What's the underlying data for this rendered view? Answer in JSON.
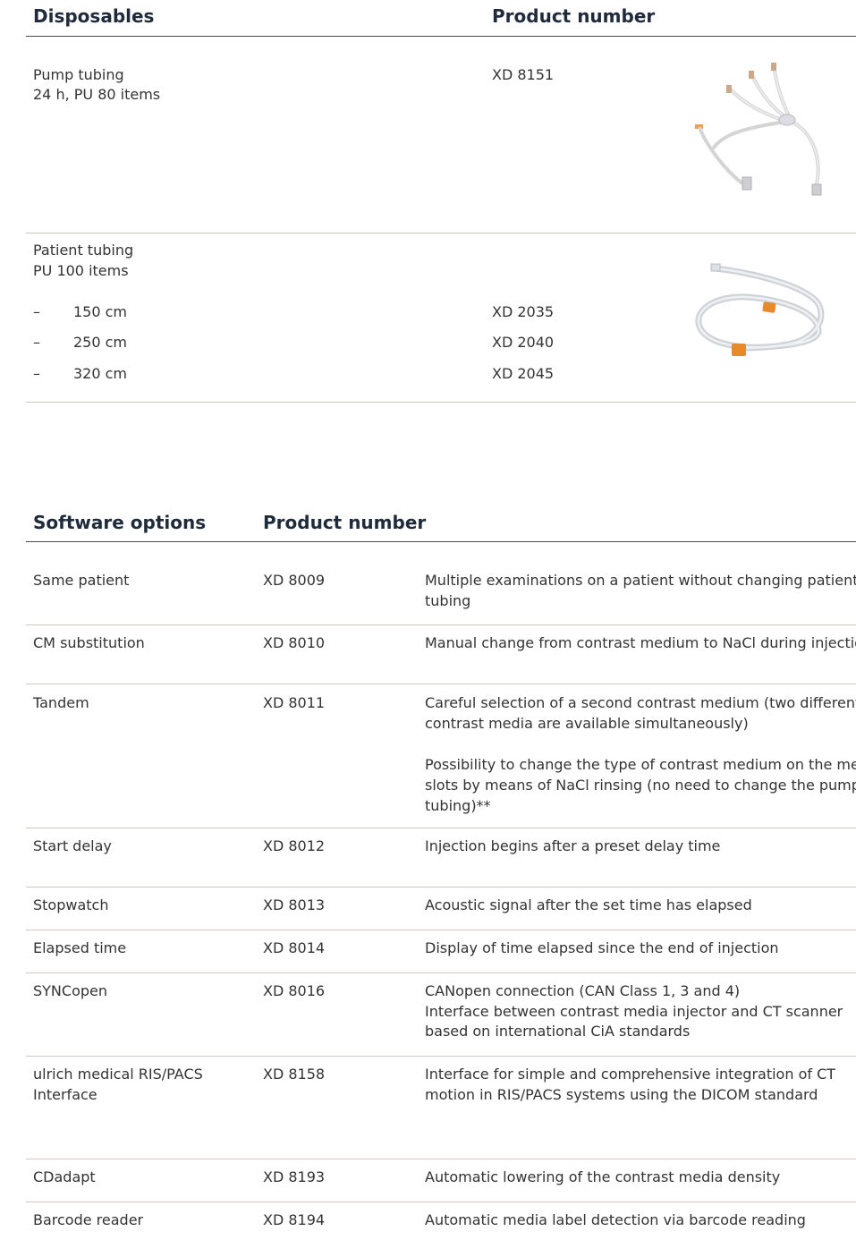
{
  "disposables": {
    "heading": "Disposables",
    "product_number_heading": "Product number",
    "pump": {
      "title": "Pump tubing",
      "subtitle": "24 h, PU 80 items",
      "number": "XD 8151"
    },
    "patient": {
      "title": "Patient tubing",
      "subtitle": "PU 100 items",
      "variants": [
        {
          "dash": "–",
          "length": "150 cm",
          "number": "XD 2035"
        },
        {
          "dash": "–",
          "length": "250 cm",
          "number": "XD 2040"
        },
        {
          "dash": "–",
          "length": "320 cm",
          "number": "XD 2045"
        }
      ]
    }
  },
  "software": {
    "heading": "Software options",
    "product_number_heading": "Product number",
    "rows": [
      {
        "name": "Same patient",
        "number": "XD 8009",
        "desc": [
          "Multiple examinations on a patient without changing patient",
          "tubing"
        ]
      },
      {
        "name": "CM substitution",
        "number": "XD 8010",
        "desc": [
          "Manual change from contrast medium to NaCl during injection"
        ]
      },
      {
        "name": "Tandem",
        "number": "XD 8011",
        "desc": [
          "Careful selection of a second contrast medium (two different",
          "contrast media are available simultaneously)",
          "",
          "Possibility to change the type of contrast medium on the media",
          "slots by means of NaCl rinsing (no need to change the pump",
          "tubing)**"
        ]
      },
      {
        "name": "Start delay",
        "number": "XD 8012",
        "desc": [
          "Injection begins after a preset delay time"
        ]
      },
      {
        "name": "Stopwatch",
        "number": "XD 8013",
        "desc": [
          "Acoustic signal after the set time has elapsed"
        ]
      },
      {
        "name": "Elapsed time",
        "number": "XD 8014",
        "desc": [
          "Display of time elapsed since the end of injection"
        ]
      },
      {
        "name": "SYNCopen",
        "number": "XD 8016",
        "desc": [
          "CANopen connection (CAN Class 1, 3 and 4)",
          "Interface between contrast media injector and CT scanner",
          "based on international CiA standards"
        ]
      },
      {
        "name": "ulrich medical RIS/PACS\nInterface",
        "number": "XD 8158",
        "desc": [
          "Interface for simple and comprehensive integration of CT",
          "motion in RIS/PACS systems using the DICOM standard"
        ]
      },
      {
        "name": "CDadapt",
        "number": "XD 8193",
        "desc": [
          "Automatic lowering of the contrast media density"
        ]
      },
      {
        "name": "Barcode reader",
        "number": "XD 8194",
        "desc": [
          "Automatic media label detection via barcode reading"
        ]
      }
    ]
  },
  "images": {
    "pump_image": "pump-tubing-image",
    "patient_image": "patient-tubing-image"
  }
}
